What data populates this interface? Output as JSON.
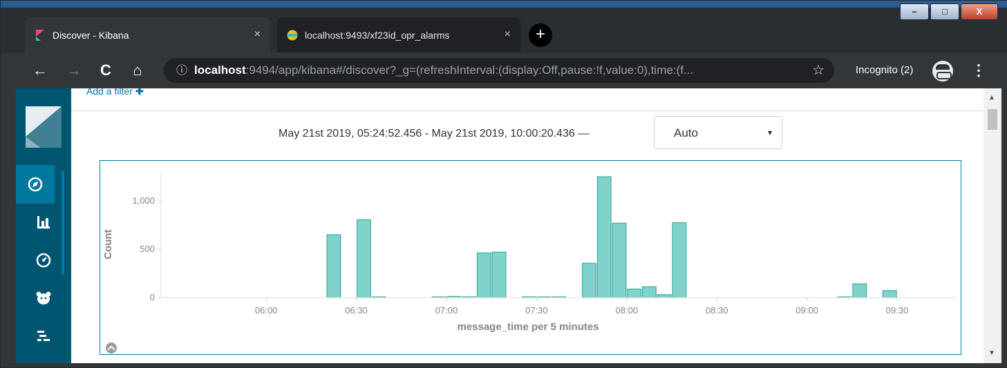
{
  "browser": {
    "tabs": [
      {
        "title": "Discover - Kibana",
        "close": "×"
      },
      {
        "title": "localhost:9493/xf23id_opr_alarms",
        "close": "×"
      }
    ],
    "new_tab": "+",
    "window_controls": {
      "minimize": "–",
      "maximize": "□",
      "close": "X"
    },
    "nav": {
      "back": "←",
      "forward": "→",
      "reload": "C",
      "home": "⌂"
    },
    "url_info": "ⓘ",
    "url_host": "localhost",
    "url_rest": ":9494/app/kibana#/discover?_g=(refreshInterval:(display:Off,pause:!f,value:0),time:(f...",
    "bookmark_star": "☆",
    "incognito_label": "Incognito (2)",
    "menu": "⋮"
  },
  "kibana": {
    "add_filter": "Add a filter",
    "add_filter_plus": "✚",
    "sidebar_items": [
      "discover",
      "visualize",
      "dashboard",
      "timelion",
      "dev-tools"
    ],
    "time_range_text": "May 21st 2019, 05:24:52.456 - May 21st 2019, 10:00:20.436 —",
    "interval": {
      "selected": "Auto",
      "caret": "▾"
    }
  },
  "colors": {
    "bar_fill": "#7fd3cb",
    "bar_stroke": "#3dab9e",
    "sidebar": "#005571",
    "accent": "#0079a5"
  },
  "chart_data": {
    "type": "bar",
    "xlabel": "message_time per 5 minutes",
    "ylabel": "Count",
    "xlim_minutes": [
      325,
      590
    ],
    "ylim": [
      0,
      1300
    ],
    "x_ticks": [
      {
        "m": 360,
        "label": "06:00"
      },
      {
        "m": 390,
        "label": "06:30"
      },
      {
        "m": 420,
        "label": "07:00"
      },
      {
        "m": 450,
        "label": "07:30"
      },
      {
        "m": 480,
        "label": "08:00"
      },
      {
        "m": 510,
        "label": "08:30"
      },
      {
        "m": 540,
        "label": "09:00"
      },
      {
        "m": 570,
        "label": "09:30"
      }
    ],
    "y_ticks": [
      {
        "v": 0,
        "label": "0"
      },
      {
        "v": 500,
        "label": "500"
      },
      {
        "v": 1000,
        "label": "1,000"
      }
    ],
    "bars": [
      {
        "t": "06:20",
        "m": 380,
        "value": 650
      },
      {
        "t": "06:30",
        "m": 390,
        "value": 805
      },
      {
        "t": "06:35",
        "m": 395,
        "value": 3
      },
      {
        "t": "06:55",
        "m": 415,
        "value": 2
      },
      {
        "t": "07:00",
        "m": 420,
        "value": 12
      },
      {
        "t": "07:05",
        "m": 425,
        "value": 8
      },
      {
        "t": "07:10",
        "m": 430,
        "value": 462
      },
      {
        "t": "07:15",
        "m": 435,
        "value": 470
      },
      {
        "t": "07:25",
        "m": 445,
        "value": 8
      },
      {
        "t": "07:30",
        "m": 450,
        "value": 3
      },
      {
        "t": "07:35",
        "m": 455,
        "value": 2
      },
      {
        "t": "07:45",
        "m": 465,
        "value": 355
      },
      {
        "t": "07:50",
        "m": 470,
        "value": 1250
      },
      {
        "t": "07:55",
        "m": 475,
        "value": 770
      },
      {
        "t": "08:00",
        "m": 480,
        "value": 88
      },
      {
        "t": "08:05",
        "m": 485,
        "value": 112
      },
      {
        "t": "08:10",
        "m": 490,
        "value": 30
      },
      {
        "t": "08:15",
        "m": 495,
        "value": 775
      },
      {
        "t": "09:10",
        "m": 550,
        "value": 5
      },
      {
        "t": "09:15",
        "m": 555,
        "value": 142
      },
      {
        "t": "09:25",
        "m": 565,
        "value": 72
      }
    ]
  }
}
